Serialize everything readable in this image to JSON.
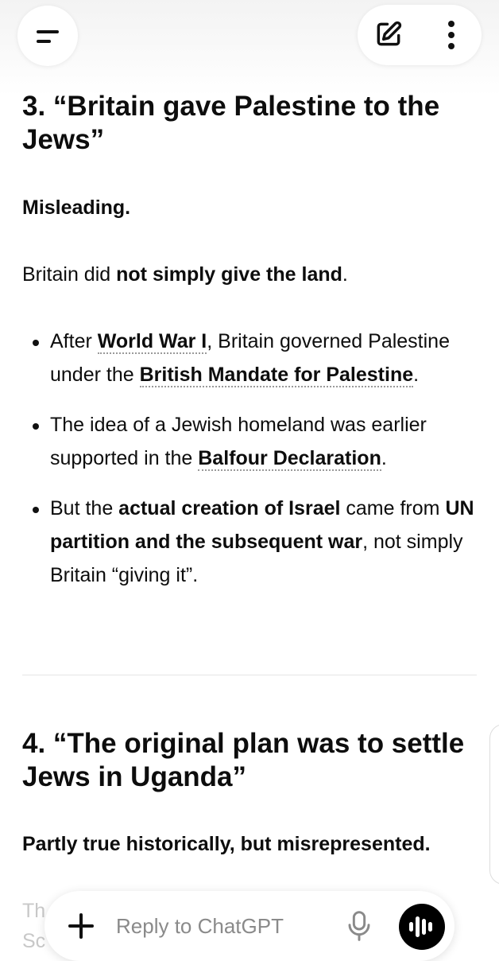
{
  "header": {
    "menu_icon": "menu-icon",
    "edit_icon": "new-chat-edit-icon",
    "more_icon": "more-vertical-icon"
  },
  "section3": {
    "heading": "3. “Britain gave Palestine to the Jews”",
    "verdict": "Misleading.",
    "intro_plain": "Britain did ",
    "intro_bold": "not simply give the land",
    "intro_end": ".",
    "bullets": [
      {
        "p1": "After ",
        "link1": "World War I",
        "p2": ", Britain governed Palestine under the ",
        "link2": "British Mandate for Palestine",
        "p3": "."
      },
      {
        "p1": "The idea of a Jewish homeland was earlier supported in the ",
        "link1": "Balfour Declaration",
        "p2": "."
      },
      {
        "p1": "But the ",
        "bold1": "actual creation of Israel",
        "p2": " came from ",
        "bold2": "UN partition and the subsequent war",
        "p3": ", not simply Britain “giving it”."
      }
    ]
  },
  "section4": {
    "heading": "4. “The original plan was to settle Jews in Uganda”",
    "verdict": "Partly true historically, but misrepresented.",
    "faded_line1": "Th",
    "faded_line2": "Sc"
  },
  "composer": {
    "placeholder": "Reply to ChatGPT",
    "plus_icon": "plus-icon",
    "mic_icon": "microphone-icon",
    "voice_icon": "voice-mode-icon"
  },
  "colors": {
    "text": "#0d0d0d",
    "link_underline": "#9a9a9a",
    "voice_button": "#000000",
    "placeholder": "#8a8a8a"
  }
}
